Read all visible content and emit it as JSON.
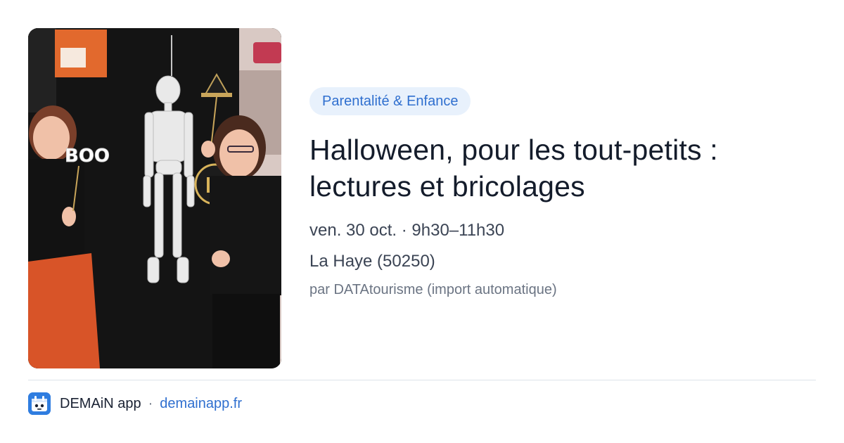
{
  "photo": {
    "alt": "",
    "props": {
      "boo_sign": "BOO"
    }
  },
  "event": {
    "category": "Parentalité & Enfance",
    "title": "Halloween, pour les tout-petits : lectures et bricolages",
    "date": "ven. 30 oct. · 9h30–11h30",
    "location": "La Haye (50250)",
    "source": "par DATAtourisme (import automatique)"
  },
  "footer": {
    "app_name": "DEMAiN app",
    "separator": "·",
    "link": "demainapp.fr",
    "logo_icon": "demain-app-logo-icon"
  },
  "colors": {
    "accent": "#2f6fcf",
    "badge_bg": "#e8f1fc",
    "title": "#141c2b",
    "muted": "#6b7483",
    "logo_bg": "#2f7de0"
  }
}
